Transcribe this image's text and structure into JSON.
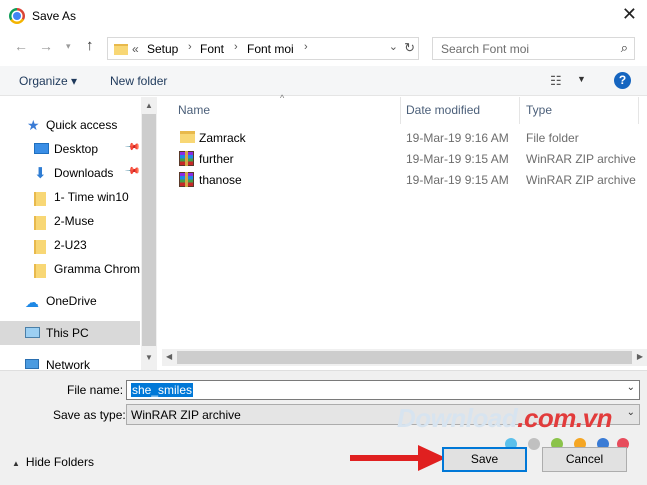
{
  "window": {
    "title": "Save As"
  },
  "address": {
    "overflow": "«",
    "crumbs": [
      "Setup",
      "Font",
      "Font moi"
    ],
    "search_placeholder": "Search Font moi"
  },
  "toolbar": {
    "organize": "Organize ▾",
    "new_folder": "New folder",
    "help": "?"
  },
  "navigation": {
    "items": [
      {
        "label": "Quick access",
        "icon": "star-icon"
      },
      {
        "label": "Desktop",
        "icon": "desktop-icon",
        "pinned": true
      },
      {
        "label": "Downloads",
        "icon": "downloads-icon",
        "pinned": true
      },
      {
        "label": "1- Time win10",
        "icon": "folder-icon"
      },
      {
        "label": "2-Muse",
        "icon": "folder-icon"
      },
      {
        "label": "2-U23",
        "icon": "folder-icon"
      },
      {
        "label": "Gramma Chrom",
        "icon": "folder-icon"
      },
      {
        "label": "OneDrive",
        "icon": "cloud-icon"
      },
      {
        "label": "This PC",
        "icon": "computer-icon",
        "selected": true
      },
      {
        "label": "Network",
        "icon": "network-icon"
      }
    ]
  },
  "files": {
    "columns": [
      "Name",
      "Date modified",
      "Type"
    ],
    "rows": [
      {
        "name": "Zamrack",
        "date": "19-Mar-19 9:16 AM",
        "type": "File folder",
        "icon": "folder-icon"
      },
      {
        "name": "further",
        "date": "19-Mar-19 9:15 AM",
        "type": "WinRAR ZIP archive",
        "icon": "winrar-icon"
      },
      {
        "name": "thanose",
        "date": "19-Mar-19 9:15 AM",
        "type": "WinRAR ZIP archive",
        "icon": "winrar-icon"
      }
    ]
  },
  "form": {
    "file_name_label": "File name:",
    "file_name_value": "she_smiles",
    "save_type_label": "Save as type:",
    "save_type_value": "WinRAR ZIP archive"
  },
  "footer": {
    "hide_folders": "Hide Folders",
    "save": "Save",
    "cancel": "Cancel"
  },
  "watermark": {
    "text_main": "Download",
    "text_dot": ".com.vn"
  },
  "colors": {
    "accent": "#0078d7",
    "selection": "#d9d9d9",
    "arrow": "#e02020"
  }
}
